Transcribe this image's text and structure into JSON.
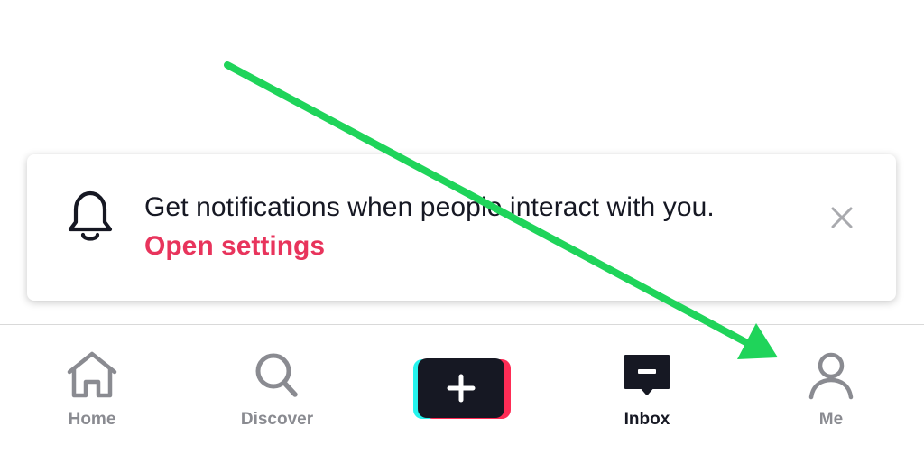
{
  "notification": {
    "message": "Get notifications when people interact with you.",
    "action_label": "Open settings"
  },
  "tabbar": {
    "tabs": [
      {
        "label": "Home",
        "icon": "home-icon"
      },
      {
        "label": "Discover",
        "icon": "search-icon"
      },
      {
        "label": "Inbox",
        "icon": "inbox-icon",
        "active": true
      },
      {
        "label": "Me",
        "icon": "person-icon"
      }
    ],
    "create_icon": "plus-icon"
  },
  "colors": {
    "accent": "#e8345c",
    "text_primary": "#161823",
    "text_inactive": "#8a8b91",
    "annotation_arrow": "#1fd45a",
    "create_cyan": "#25f4ee",
    "create_pink": "#fe2c55"
  }
}
